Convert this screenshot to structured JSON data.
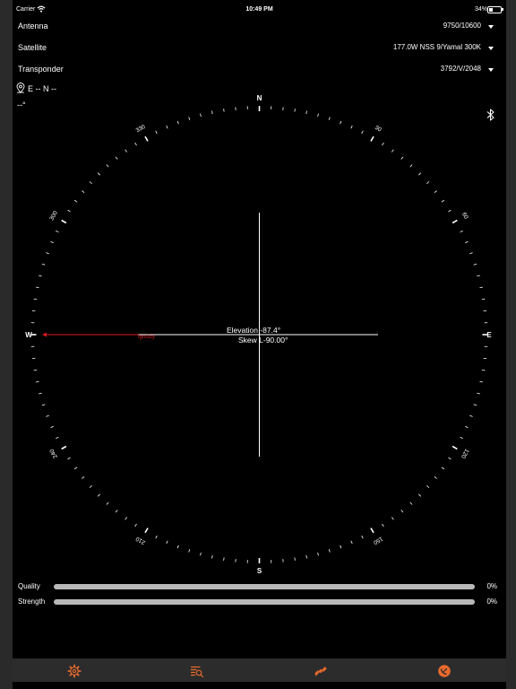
{
  "status_bar": {
    "carrier": "Carrier",
    "time": "10:49 PM",
    "battery": "34%",
    "battery_level": 0.34
  },
  "settings": {
    "antenna": {
      "label": "Antenna",
      "value": "9750/10600"
    },
    "satellite": {
      "label": "Satellite",
      "value": "177.0W  NSS 9/Yamal 300K"
    },
    "transponder": {
      "label": "Transponder",
      "value": "3792/V/2048"
    }
  },
  "location": {
    "text": "E -- N --",
    "heading": "--°"
  },
  "compass": {
    "cardinals": {
      "north": "N",
      "east": "E",
      "south": "S",
      "west": "W"
    },
    "degree_labels": [
      "30",
      "60",
      "120",
      "150",
      "210",
      "240",
      "300",
      "330"
    ],
    "elevation": "Elevation -87.4°",
    "skew": "Skew L-90.00°",
    "azimuth_marker": "Ignuizy"
  },
  "meters": [
    {
      "label": "Quality",
      "percent": "0%",
      "value": 0
    },
    {
      "label": "Strength",
      "percent": "0%",
      "value": 0
    }
  ],
  "tabs": [
    {
      "icon": "settings-gear-icon"
    },
    {
      "icon": "list-search-icon"
    },
    {
      "icon": "satellite-icon"
    },
    {
      "icon": "satellite-dish-icon"
    }
  ],
  "colors": {
    "accent": "#e86a2c",
    "needle": "#d71920",
    "background": "#000000"
  }
}
